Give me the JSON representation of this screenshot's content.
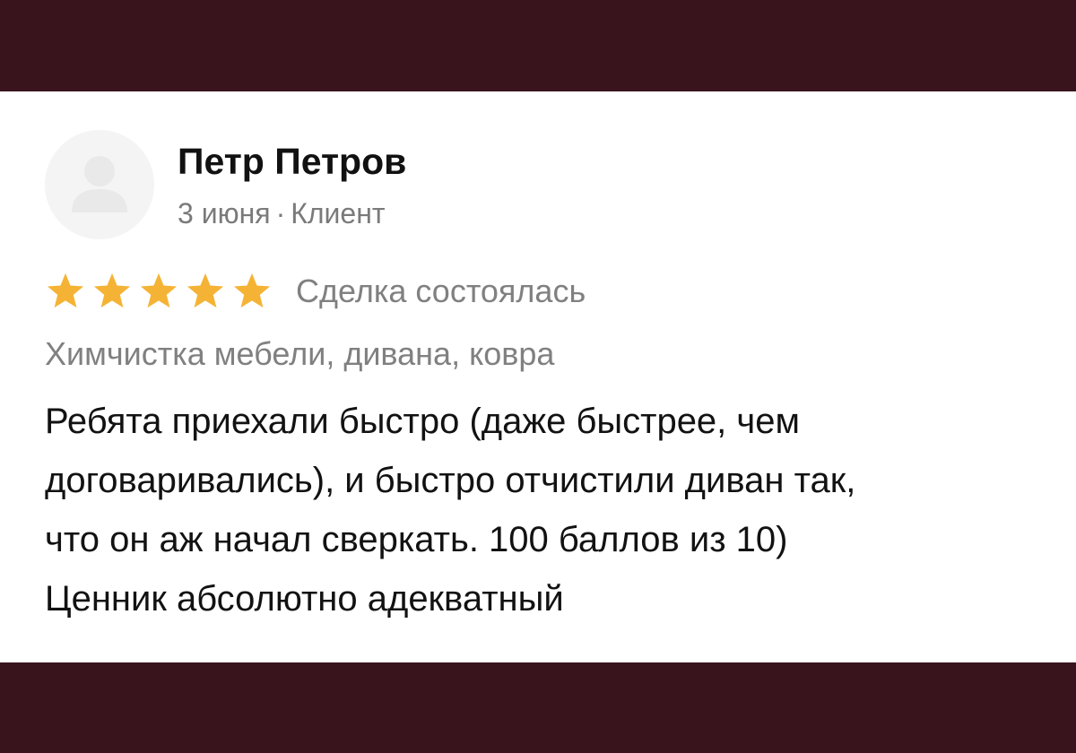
{
  "review": {
    "author": "Петр Петров",
    "date": "3 июня",
    "separator": "·",
    "role": "Клиент",
    "avatar_icon": "user-silhouette-icon",
    "rating": 5,
    "rating_max": 5,
    "star_color": "#f5b335",
    "deal_status": "Сделка состоялась",
    "service": "Химчистка мебели, дивана, ковра",
    "text_lines": [
      "Ребята приехали быстро (даже быстрее, чем",
      "договаривались), и быстро отчистили диван так,",
      "что он аж начал сверкать. 100 баллов из 10)",
      "Ценник абсолютно адекватный"
    ]
  },
  "colors": {
    "background": "#3a141d",
    "card": "#ffffff",
    "primary_text": "#111111",
    "secondary_text": "#808080"
  }
}
